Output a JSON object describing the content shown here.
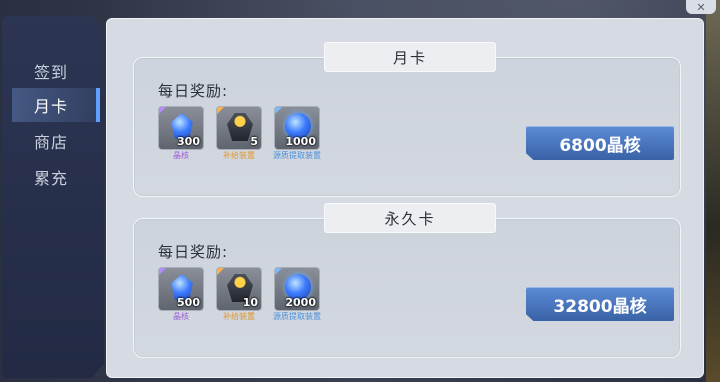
{
  "sidebar": {
    "items": [
      {
        "label": "签到",
        "active": false
      },
      {
        "label": "月卡",
        "active": true
      },
      {
        "label": "商店",
        "active": false
      },
      {
        "label": "累充",
        "active": false
      }
    ]
  },
  "cards": [
    {
      "title": "月卡",
      "reward_label": "每日奖励:",
      "price": "6800晶核",
      "items": [
        {
          "icon": "crystal-icon",
          "qty": "300",
          "name": "晶核",
          "name_color": "#9a5cd6"
        },
        {
          "icon": "supply-device-icon",
          "qty": "5",
          "name": "补给装置",
          "name_color": "#e0962a"
        },
        {
          "icon": "source-extract-device-icon",
          "qty": "1000",
          "name": "源质提取装置",
          "name_color": "#4a8fd8"
        }
      ]
    },
    {
      "title": "永久卡",
      "reward_label": "每日奖励:",
      "price": "32800晶核",
      "items": [
        {
          "icon": "crystal-icon",
          "qty": "500",
          "name": "晶核",
          "name_color": "#9a5cd6"
        },
        {
          "icon": "supply-device-icon",
          "qty": "10",
          "name": "补给装置",
          "name_color": "#e0962a"
        },
        {
          "icon": "source-extract-device-icon",
          "qty": "2000",
          "name": "源质提取装置",
          "name_color": "#4a8fd8"
        }
      ]
    }
  ]
}
